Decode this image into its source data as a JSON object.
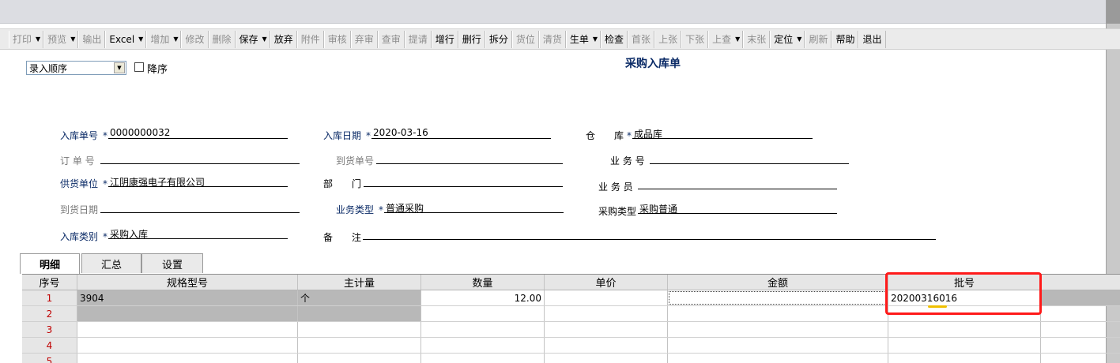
{
  "toolbar": [
    {
      "label": "打印",
      "arrow": true,
      "enabled": false
    },
    {
      "label": "预览",
      "arrow": true,
      "enabled": false
    },
    {
      "label": "输出",
      "arrow": false,
      "enabled": false
    },
    {
      "label": "Excel",
      "arrow": true,
      "enabled": true
    },
    {
      "label": "增加",
      "arrow": true,
      "enabled": false
    },
    {
      "label": "修改",
      "arrow": false,
      "enabled": false
    },
    {
      "label": "删除",
      "arrow": false,
      "enabled": false
    },
    {
      "label": "保存",
      "arrow": true,
      "enabled": true
    },
    {
      "label": "放弃",
      "arrow": false,
      "enabled": true
    },
    {
      "label": "附件",
      "arrow": false,
      "enabled": false
    },
    {
      "label": "审核",
      "arrow": false,
      "enabled": false
    },
    {
      "label": "弃审",
      "arrow": false,
      "enabled": false
    },
    {
      "label": "查审",
      "arrow": false,
      "enabled": false
    },
    {
      "label": "提请",
      "arrow": false,
      "enabled": false
    },
    {
      "label": "增行",
      "arrow": false,
      "enabled": true
    },
    {
      "label": "删行",
      "arrow": false,
      "enabled": true
    },
    {
      "label": "拆分",
      "arrow": false,
      "enabled": true
    },
    {
      "label": "货位",
      "arrow": false,
      "enabled": false
    },
    {
      "label": "清货",
      "arrow": false,
      "enabled": false
    },
    {
      "label": "生单",
      "arrow": true,
      "enabled": true
    },
    {
      "label": "检查",
      "arrow": false,
      "enabled": true
    },
    {
      "label": "首张",
      "arrow": false,
      "enabled": false
    },
    {
      "label": "上张",
      "arrow": false,
      "enabled": false
    },
    {
      "label": "下张",
      "arrow": false,
      "enabled": false
    },
    {
      "label": "上查",
      "arrow": true,
      "enabled": false
    },
    {
      "label": "末张",
      "arrow": false,
      "enabled": false
    },
    {
      "label": "定位",
      "arrow": true,
      "enabled": true
    },
    {
      "label": "刷新",
      "arrow": false,
      "enabled": false
    },
    {
      "label": "帮助",
      "arrow": false,
      "enabled": true
    },
    {
      "label": "退出",
      "arrow": false,
      "enabled": true
    }
  ],
  "sort": {
    "value": "录入顺序",
    "desc_label": "降序",
    "desc_checked": false
  },
  "form_title": "采购入库单",
  "fields": {
    "receipt_no": {
      "label": "入库单号",
      "value": "0000000032"
    },
    "receipt_date": {
      "label": "入库日期",
      "value": "2020-03-16"
    },
    "warehouse": {
      "label": "仓　　库",
      "value": "成品库"
    },
    "order_no": {
      "label": "订 单 号",
      "value": ""
    },
    "arrival_no": {
      "label": "到货单号",
      "value": ""
    },
    "business_no": {
      "label": "业 务 号",
      "value": ""
    },
    "supplier": {
      "label": "供货单位",
      "value": "江阴康强电子有限公司"
    },
    "dept": {
      "label": "部　　门",
      "value": ""
    },
    "salesman": {
      "label": "业 务 员",
      "value": ""
    },
    "arrival_date": {
      "label": "到货日期",
      "value": ""
    },
    "biz_type": {
      "label": "业务类型",
      "value": "普通采购"
    },
    "purchase_type": {
      "label": "采购类型",
      "value": "采购普通"
    },
    "receipt_type": {
      "label": "入库类别",
      "value": "采购入库"
    },
    "remark": {
      "label": "备　　注",
      "value": ""
    }
  },
  "required_mark": "*",
  "tabs": [
    {
      "label": "明细",
      "active": true
    },
    {
      "label": "汇总",
      "active": false
    },
    {
      "label": "设置",
      "active": false
    }
  ],
  "grid": {
    "headers": [
      "序号",
      "规格型号",
      "主计量",
      "数量",
      "单价",
      "金额",
      "批号",
      ""
    ],
    "rows": [
      {
        "no": "1",
        "spec": "3904",
        "unit": "个",
        "qty": "12.00",
        "price": "",
        "amount": "",
        "batch": "20200316016"
      },
      {
        "no": "2",
        "spec": "",
        "unit": "",
        "qty": "",
        "price": "",
        "amount": "",
        "batch": ""
      },
      {
        "no": "3",
        "spec": "",
        "unit": "",
        "qty": "",
        "price": "",
        "amount": "",
        "batch": ""
      },
      {
        "no": "4",
        "spec": "",
        "unit": "",
        "qty": "",
        "price": "",
        "amount": "",
        "batch": ""
      },
      {
        "no": "5",
        "spec": "",
        "unit": "",
        "qty": "",
        "price": "",
        "amount": "",
        "batch": ""
      }
    ]
  },
  "colors": {
    "label_blue": "#0a2a66",
    "highlight_red": "#ff1a1a",
    "row_number_red": "#c00000",
    "underline_yellow": "#f0c000"
  }
}
